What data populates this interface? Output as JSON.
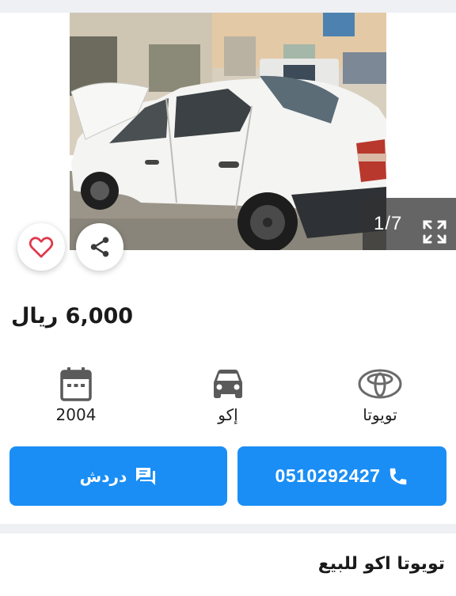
{
  "gallery": {
    "counter": "1/7",
    "icons": {
      "prev": "chevron-left-icon",
      "next": "chevron-right-icon",
      "expand": "expand-icon",
      "favorite": "heart-icon",
      "share": "share-icon"
    }
  },
  "listing": {
    "price": "6,000 ريال",
    "title": "تويوتا اكو للبيع",
    "specs": {
      "year": {
        "icon": "calendar-icon",
        "label": "2004"
      },
      "model": {
        "icon": "car-icon",
        "label": "إكو"
      },
      "make": {
        "icon": "toyota-logo",
        "label": "تويوتا"
      }
    }
  },
  "actions": {
    "chat": {
      "icon": "chat-icon",
      "label": "دردش"
    },
    "call": {
      "icon": "phone-icon",
      "label": "0510292427"
    }
  },
  "colors": {
    "accent": "#1a8ef5",
    "heart": "#e0384b",
    "divider": "#eef0f4"
  }
}
